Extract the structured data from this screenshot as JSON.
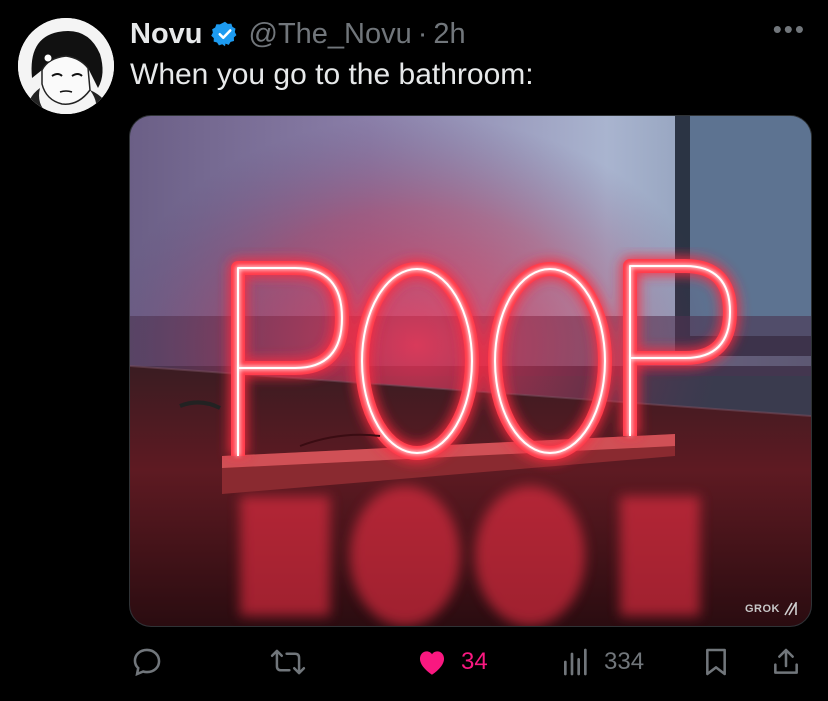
{
  "author": {
    "name": "Novu",
    "handle": "@The_Novu",
    "separator": "·",
    "time": "2h",
    "verified_icon": "verified-badge-icon"
  },
  "tweet": {
    "text": "When you go to the bathroom:"
  },
  "media": {
    "sign_text": "POOP",
    "watermark": "GROK"
  },
  "actions": {
    "reply_count": "",
    "retweet_count": "",
    "like_count": "34",
    "views_count": "334"
  },
  "colors": {
    "background": "#000000",
    "text_primary": "#e7e9ea",
    "text_secondary": "#71767b",
    "verified_blue": "#1d9bf0",
    "like_pink": "#f91880",
    "neon_red": "#ff3b4a"
  }
}
